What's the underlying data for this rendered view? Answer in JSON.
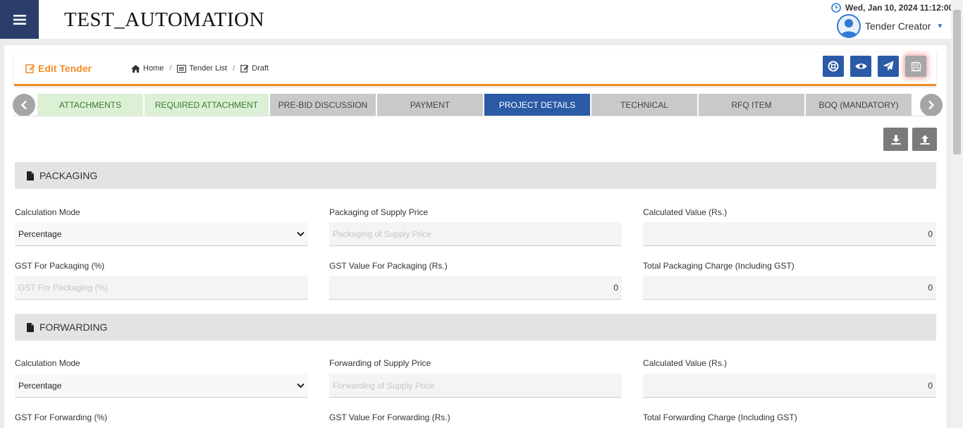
{
  "app": {
    "title": "TEST_AUTOMATION"
  },
  "header": {
    "datetime": "Wed, Jan 10, 2024 11:12:00",
    "user_name": "Tender Creator"
  },
  "page": {
    "title": "Edit Tender"
  },
  "breadcrumb": [
    {
      "label": "Home",
      "icon": "home-icon"
    },
    {
      "label": "Tender List",
      "icon": "list-icon"
    },
    {
      "label": "Draft",
      "icon": "edit-icon"
    }
  ],
  "actions": [
    "help-icon",
    "view-icon",
    "send-icon",
    "save-icon"
  ],
  "tabs": [
    {
      "label": "ATTACHMENTS",
      "state": "done"
    },
    {
      "label": "REQUIRED ATTACHMENT",
      "state": "done"
    },
    {
      "label": "PRE-BID DISCUSSION",
      "state": "grey"
    },
    {
      "label": "PAYMENT",
      "state": "grey"
    },
    {
      "label": "PROJECT DETAILS",
      "state": "active"
    },
    {
      "label": "TECHNICAL",
      "state": "grey"
    },
    {
      "label": "RFQ ITEM",
      "state": "grey"
    },
    {
      "label": "BOQ (MANDATORY)",
      "state": "grey"
    }
  ],
  "packaging": {
    "title": "PACKAGING",
    "calc_mode_label": "Calculation Mode",
    "calc_mode_value": "Percentage",
    "supply_price_label": "Packaging of Supply Price",
    "supply_price_placeholder": "Packaging of Supply Price",
    "calc_value_label": "Calculated Value (Rs.)",
    "calc_value": "0",
    "gst_label": "GST For Packaging (%)",
    "gst_placeholder": "GST For Packaging (%)",
    "gst_value_label": "GST Value For Packaging (Rs.)",
    "gst_value": "0",
    "total_label": "Total Packaging Charge (Including GST)",
    "total_value": "0"
  },
  "forwarding": {
    "title": "FORWARDING",
    "calc_mode_label": "Calculation Mode",
    "calc_mode_value": "Percentage",
    "supply_price_label": "Forwarding of Supply Price",
    "supply_price_placeholder": "Forwarding of Supply Price",
    "calc_value_label": "Calculated Value (Rs.)",
    "calc_value": "0",
    "gst_label": "GST For Forwarding (%)",
    "gst_value_label": "GST Value For Forwarding (Rs.)",
    "total_label": "Total Forwarding Charge (Including GST)"
  },
  "colors": {
    "primary": "#2b5aa6",
    "accent": "#f28c28",
    "tab_done": "#dcf0d6"
  }
}
